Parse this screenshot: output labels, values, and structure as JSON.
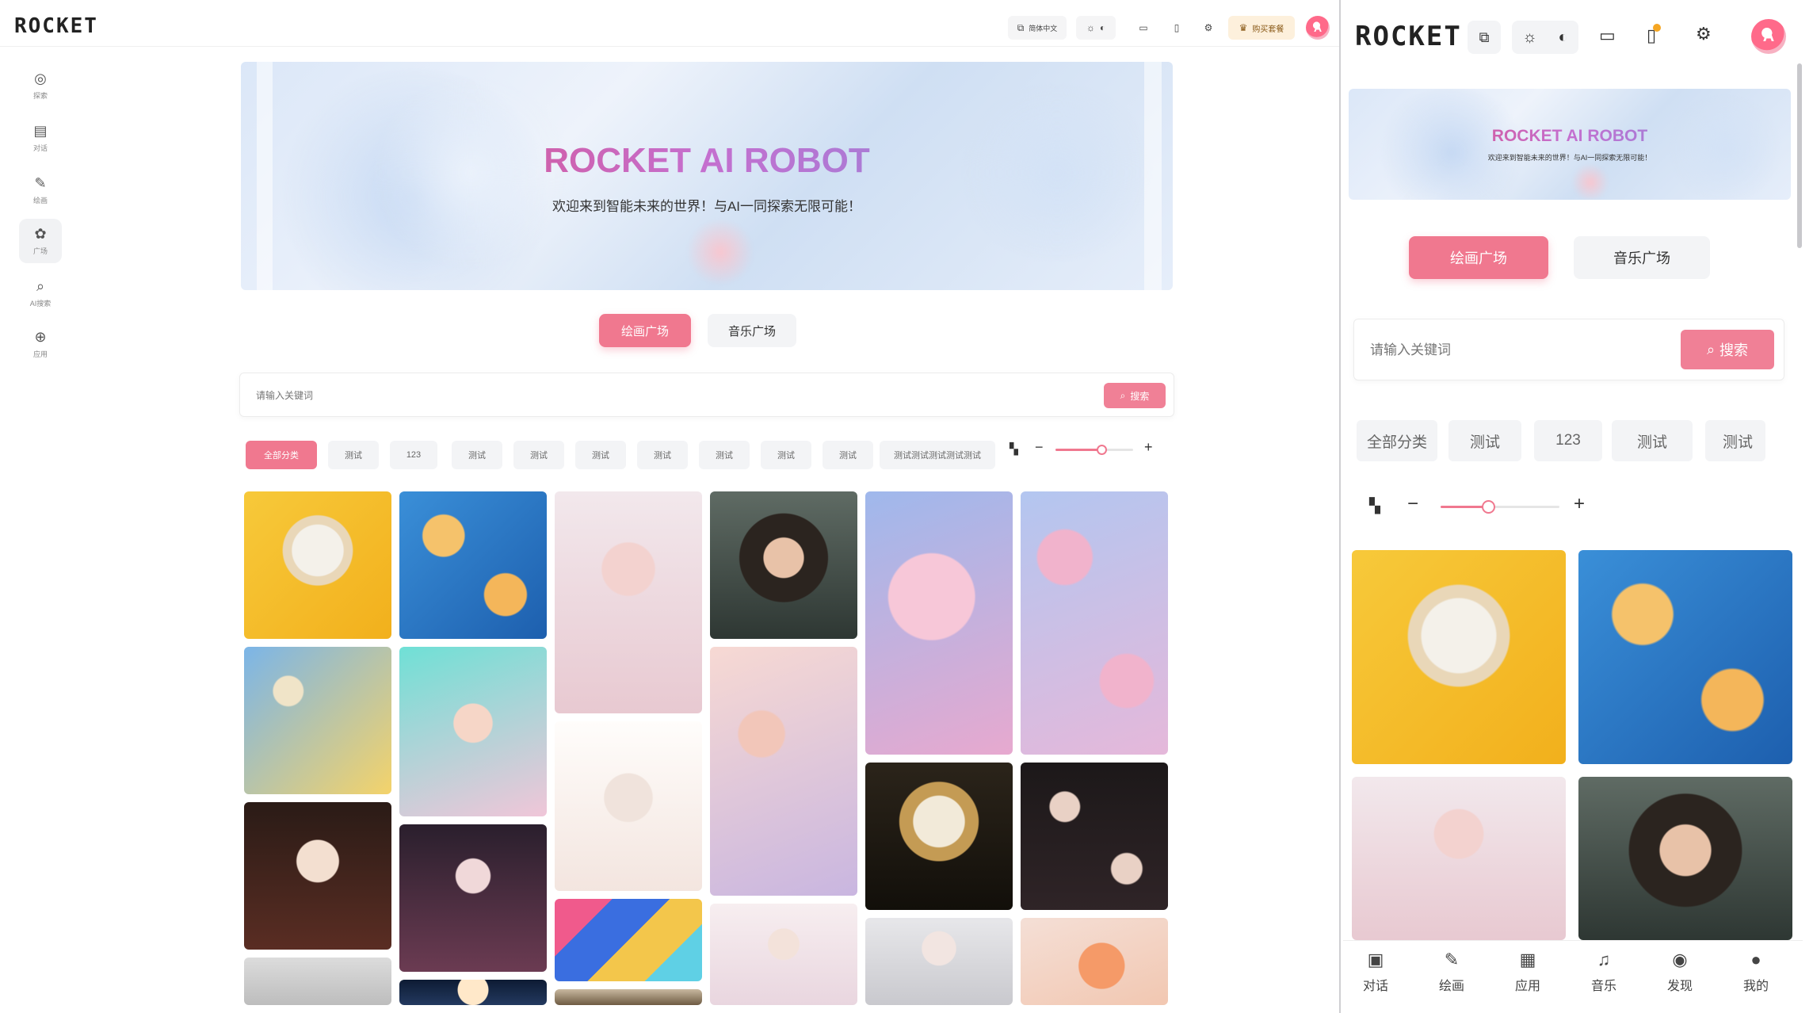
{
  "colors": {
    "accent": "#f0788f",
    "warm_btn": "#fdf0dc"
  },
  "desktop": {
    "logo": "ROCKET",
    "topbar": {
      "translate_label": "简体中文",
      "translate_icon": "translate-icon",
      "vip_label": "购买套餐"
    },
    "sidebar": [
      {
        "icon": "compass-icon",
        "glyph": "◎",
        "label": "探索",
        "active": false
      },
      {
        "icon": "chat-icon",
        "glyph": "▤",
        "label": "对话",
        "active": false
      },
      {
        "icon": "brush-icon",
        "glyph": "✎",
        "label": "绘画",
        "active": false
      },
      {
        "icon": "palette-icon",
        "glyph": "✿",
        "label": "广场",
        "active": true
      },
      {
        "icon": "search-icon",
        "glyph": "⌕",
        "label": "AI搜索",
        "active": false
      },
      {
        "icon": "globe-icon",
        "glyph": "⊕",
        "label": "应用",
        "active": false
      }
    ],
    "banner": {
      "title": "ROCKET AI ROBOT",
      "subtitle": "欢迎来到智能未来的世界！与AI一同探索无限可能！"
    },
    "tabs": [
      "绘画广场",
      "音乐广场"
    ],
    "search": {
      "placeholder": "请输入关键词",
      "button": "搜索"
    },
    "categories": [
      "全部分类",
      "测试",
      "123",
      "测试",
      "测试",
      "测试",
      "测试",
      "测试",
      "测试",
      "测试",
      "测试测试测试测试测试"
    ],
    "zoom": {
      "level": 0.6
    }
  },
  "mobile": {
    "logo": "ROCKET",
    "banner": {
      "title": "ROCKET AI ROBOT",
      "subtitle": "欢迎来到智能未来的世界！与AI一同探索无限可能！"
    },
    "tabs": [
      "绘画广场",
      "音乐广场"
    ],
    "search": {
      "placeholder": "请输入关键词",
      "button": "搜索"
    },
    "categories": [
      "全部分类",
      "测试",
      "123",
      "测试",
      "测试"
    ],
    "zoom": {
      "level": 0.4
    },
    "bottom_nav": [
      {
        "icon": "chat-icon",
        "glyph": "▣",
        "label": "对话"
      },
      {
        "icon": "brush-icon",
        "glyph": "✎",
        "label": "绘画"
      },
      {
        "icon": "apps-icon",
        "glyph": "▦",
        "label": "应用"
      },
      {
        "icon": "music-icon",
        "glyph": "♫",
        "label": "音乐"
      },
      {
        "icon": "discover-icon",
        "glyph": "◉",
        "label": "发现"
      },
      {
        "icon": "user-icon",
        "glyph": "●",
        "label": "我的"
      }
    ]
  }
}
